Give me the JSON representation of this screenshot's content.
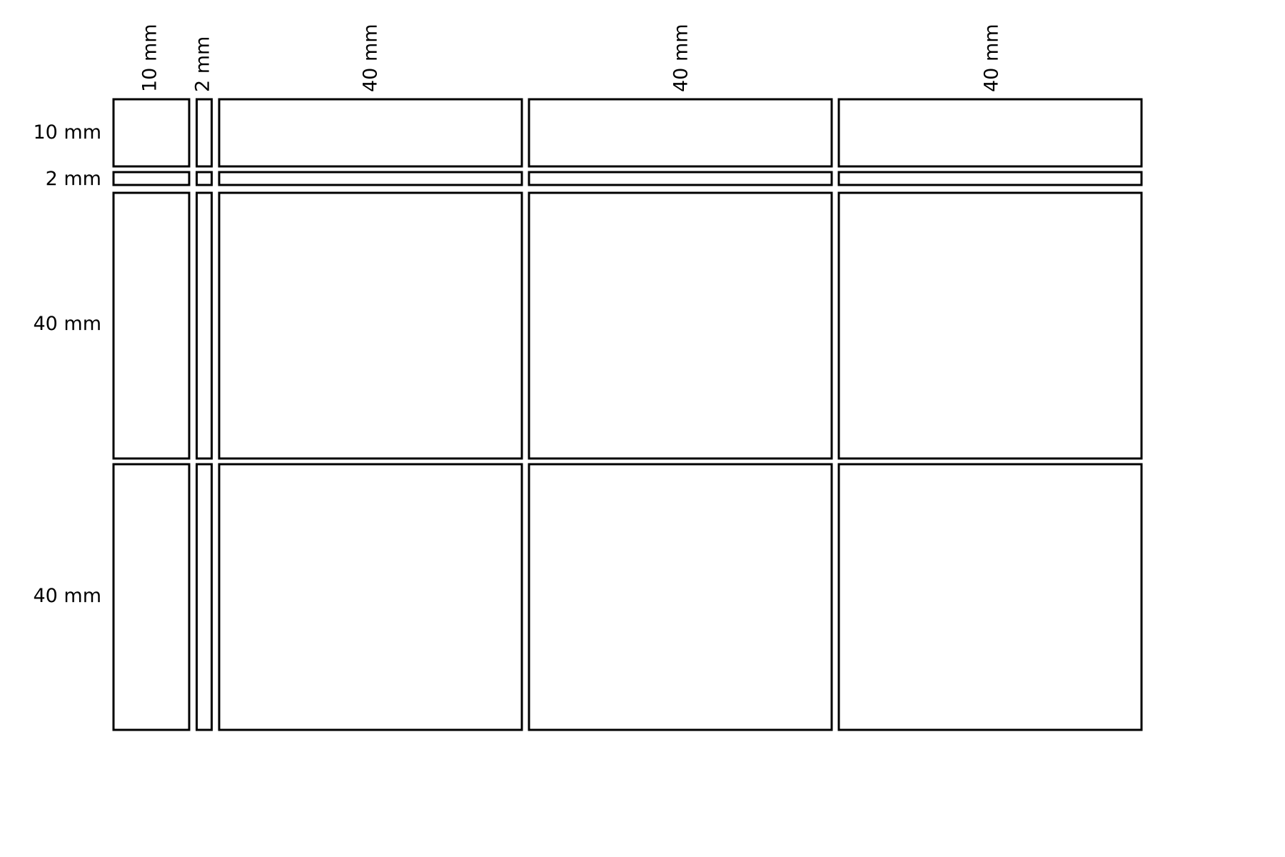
{
  "grid": {
    "columns": [
      {
        "label": "10 mm",
        "size_mm": 10
      },
      {
        "label": "2 mm",
        "size_mm": 2
      },
      {
        "label": "40 mm",
        "size_mm": 40
      },
      {
        "label": "40 mm",
        "size_mm": 40
      },
      {
        "label": "40 mm",
        "size_mm": 40
      }
    ],
    "rows": [
      {
        "label": "10 mm",
        "size_mm": 10
      },
      {
        "label": "2 mm",
        "size_mm": 2
      },
      {
        "label": "40 mm",
        "size_mm": 40
      },
      {
        "label": "40 mm",
        "size_mm": 40
      }
    ],
    "stroke_color": "#000000",
    "background_color": "#ffffff"
  }
}
